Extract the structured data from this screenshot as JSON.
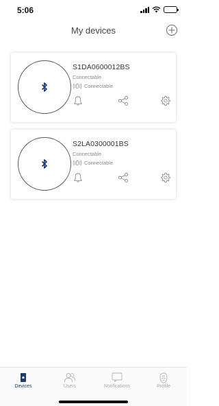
{
  "status_bar": {
    "time": "5:06"
  },
  "header": {
    "title": "My devices"
  },
  "devices": [
    {
      "name": "S1DA0600012BS",
      "status": "Connectable",
      "connection": "Connectable"
    },
    {
      "name": "S2LA0300001BS",
      "status": "Connectable",
      "connection": "Connectable"
    }
  ],
  "bottom_nav": {
    "items": [
      {
        "label": "Devices",
        "icon": "device-icon",
        "active": true
      },
      {
        "label": "Users",
        "icon": "users-icon",
        "active": false
      },
      {
        "label": "Notifications",
        "icon": "notifications-icon",
        "active": false
      },
      {
        "label": "Profile",
        "icon": "profile-icon",
        "active": false
      }
    ]
  },
  "colors": {
    "accent": "#1d3a6e",
    "muted": "#8a8a8a",
    "icon": "#8a8a8a"
  }
}
